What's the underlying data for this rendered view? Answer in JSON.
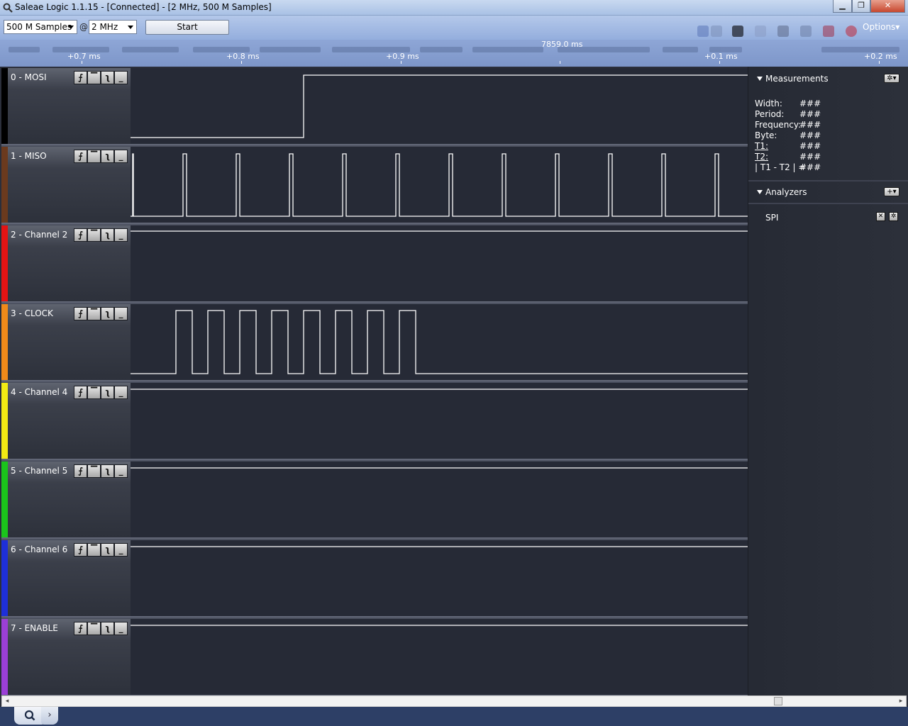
{
  "window": {
    "title": "Saleae Logic 1.1.15 - [Connected] - [2 MHz, 500 M Samples]",
    "minimize_label": "▁",
    "restore_label": "❐",
    "close_label": "✕"
  },
  "toolbar": {
    "samples_value": "500 M Samples",
    "at_sign": "@",
    "rate_value": "2 MHz",
    "start_label": "Start",
    "options_label": "Options▾"
  },
  "ruler": {
    "center_time": "7859.0 ms",
    "ticks": [
      "+0.7 ms",
      "+0.8 ms",
      "+0.9 ms",
      "+0.1 ms",
      "+0.2 ms"
    ]
  },
  "channels": [
    {
      "label": "0 - MOSI",
      "color": "#000000"
    },
    {
      "label": "1 - MISO",
      "color": "#6b3a1e"
    },
    {
      "label": "2 - Channel 2",
      "color": "#e31414"
    },
    {
      "label": "3 - CLOCK",
      "color": "#f08a1a"
    },
    {
      "label": "4 - Channel 4",
      "color": "#f2ea14"
    },
    {
      "label": "5 - Channel 5",
      "color": "#1bc41b"
    },
    {
      "label": "6 - Channel 6",
      "color": "#1e2fd8"
    },
    {
      "label": "7 - ENABLE",
      "color": "#9b3fd6"
    }
  ],
  "trigger_buttons": [
    "⨍",
    "▔",
    "ʅ",
    "_"
  ],
  "measurements": {
    "title": "Measurements",
    "rows": [
      {
        "label": "Width:",
        "value": "###"
      },
      {
        "label": "Period:",
        "value": "###"
      },
      {
        "label": "Frequency:",
        "value": "###"
      },
      {
        "label": "Byte:",
        "value": "###"
      },
      {
        "label": "T1:",
        "value": "###"
      },
      {
        "label": "T2:",
        "value": "###"
      },
      {
        "label": "| T1 - T2 | =",
        "value": "###"
      }
    ],
    "settings_label": "✲▾"
  },
  "analyzers": {
    "title": "Analyzers",
    "add_label": "+▾",
    "items": [
      {
        "name": "SPI"
      }
    ]
  },
  "scrollbar": {
    "left_arrow": "◂",
    "right_arrow": "▸"
  },
  "bottom": {
    "arrow_label": "›"
  }
}
